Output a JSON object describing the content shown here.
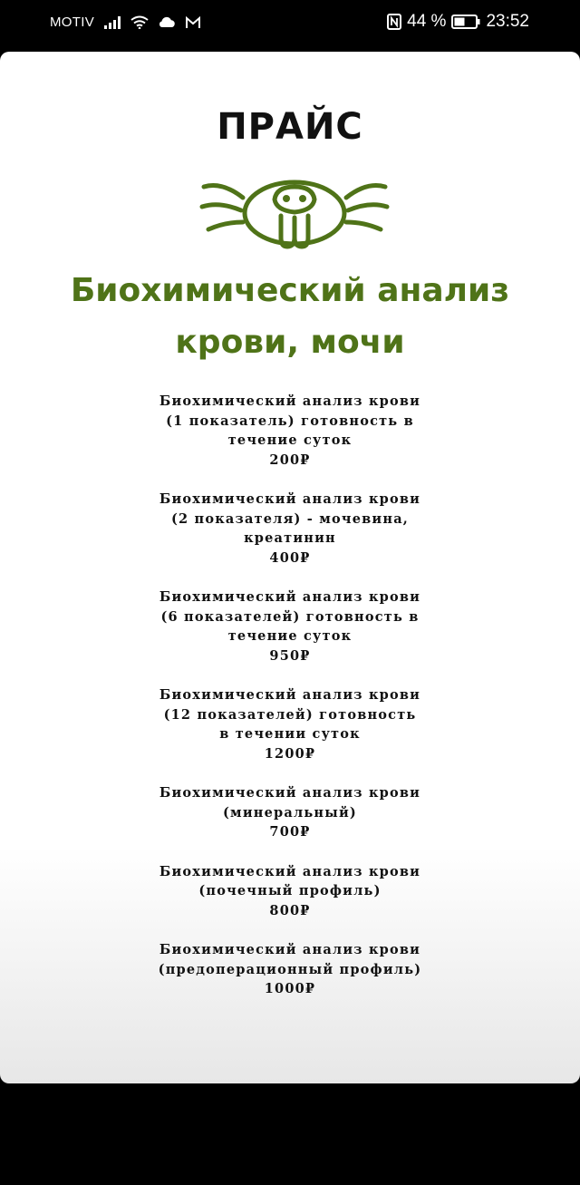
{
  "status_bar": {
    "carrier": "MOTIV",
    "battery_percent": "44 %",
    "time": "23:52",
    "icons": [
      "signal-icon",
      "wifi-icon",
      "cloud-icon",
      "mail-icon",
      "nfc-icon",
      "battery-icon"
    ]
  },
  "page": {
    "title": "ПРАЙС",
    "headline_line1": "Биохимический анализ",
    "headline_line2": "крови, мочи",
    "accent_color": "#4f7318",
    "logo_icon": "beaver-face-icon"
  },
  "services": [
    {
      "lines": [
        "Биохимический анализ крови",
        "(1 показатель) готовность в",
        "течение суток"
      ],
      "price": "200₽"
    },
    {
      "lines": [
        "Биохимический анализ крови",
        "(2 показателя) - мочевина,",
        "креатинин"
      ],
      "price": "400₽"
    },
    {
      "lines": [
        "Биохимический анализ крови",
        "(6 показателей) готовность в",
        "течение суток"
      ],
      "price": "950₽"
    },
    {
      "lines": [
        "Биохимический анализ крови",
        "(12 показателей) готовность",
        "в течении суток"
      ],
      "price": "1200₽"
    },
    {
      "lines": [
        "Биохимический анализ крови",
        "(минеральный)"
      ],
      "price": "700₽"
    },
    {
      "lines": [
        "Биохимический анализ крови",
        "(почечный профиль)"
      ],
      "price": "800₽"
    },
    {
      "lines": [
        "Биохимический анализ крови",
        "(предоперационный профиль)"
      ],
      "price": "1000₽"
    }
  ]
}
